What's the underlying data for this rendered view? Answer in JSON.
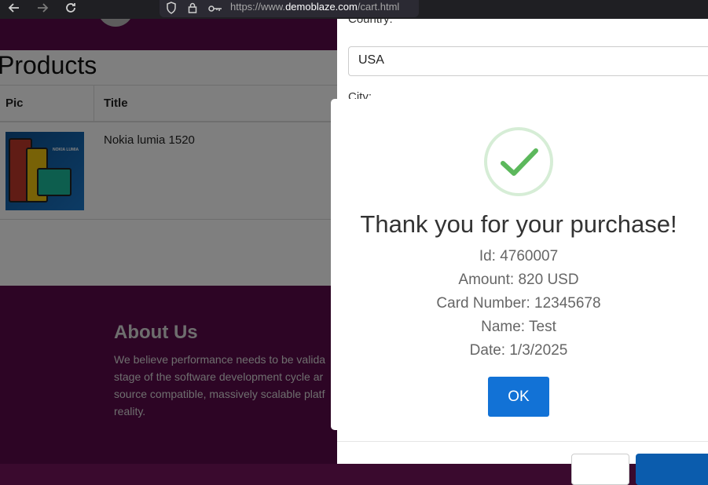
{
  "browser": {
    "url_scheme": "https://www.",
    "url_domain": "demoblaze.com",
    "url_path": "/cart.html",
    "back_icon": "arrow-left-icon",
    "forward_icon": "arrow-right-icon",
    "reload_icon": "reload-icon"
  },
  "page": {
    "products_title": "Products",
    "columns": [
      "Pic",
      "Title"
    ],
    "rows": [
      {
        "title": "Nokia lumia 1520",
        "image_brand": "NOKIA LUMIA"
      }
    ],
    "about_title": "About Us",
    "about_text": "We believe performance needs to be valida stage of the software development cycle ar source compatible, massively scalable platf reality."
  },
  "order_form": {
    "country_label": "Country:",
    "country_value": "USA",
    "city_label": "City:"
  },
  "alert": {
    "title": "Thank you for your purchase!",
    "id_line": "Id: 4760007",
    "amount_line": "Amount: 820 USD",
    "card_line": "Card Number: 12345678",
    "name_line": "Name: Test",
    "date_line": "Date: 1/3/2025",
    "ok_label": "OK",
    "success_color": "#5cb85c",
    "ok_color": "#1272d6"
  }
}
